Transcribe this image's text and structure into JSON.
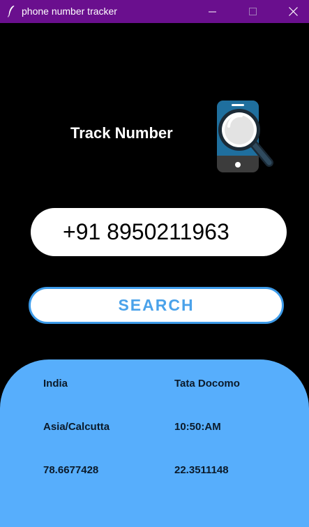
{
  "window": {
    "title": "phone number tracker",
    "title_bar_color": "#6a0f8e"
  },
  "header": {
    "title": "Track Number",
    "icon": "phone-search-icon"
  },
  "input": {
    "value": "+91 8950211963"
  },
  "search_button": {
    "label": "SEARCH",
    "accent_color": "#3d9be9"
  },
  "results": {
    "panel_color": "#57aefc",
    "country": "India",
    "carrier": "Tata Docomo",
    "timezone": "Asia/Calcutta",
    "time": "10:50:AM",
    "longitude": "78.6677428",
    "latitude": "22.3511148"
  }
}
